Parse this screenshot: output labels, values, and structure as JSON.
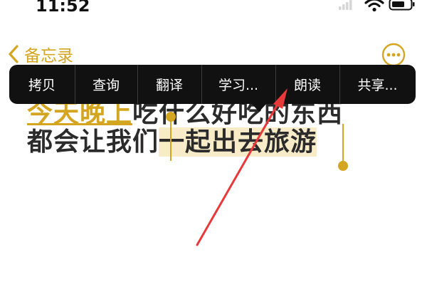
{
  "status_bar": {
    "time": "11:52"
  },
  "nav": {
    "back_label": "备忘录"
  },
  "context_menu": {
    "items": [
      {
        "label": "拷贝"
      },
      {
        "label": "查询"
      },
      {
        "label": "翻译"
      },
      {
        "label": "学习..."
      },
      {
        "label": "朗读"
      },
      {
        "label": "共享..."
      }
    ]
  },
  "note": {
    "line1_selected_fragment": "今天晚上",
    "line1_rest": "吃什么好吃的东西",
    "line2_plain": "都会让我们",
    "line2_selected": "一起出去旅游"
  },
  "colors": {
    "accent": "#d4a520",
    "menu_bg": "#111111",
    "annotation_arrow": "#e8393a"
  }
}
